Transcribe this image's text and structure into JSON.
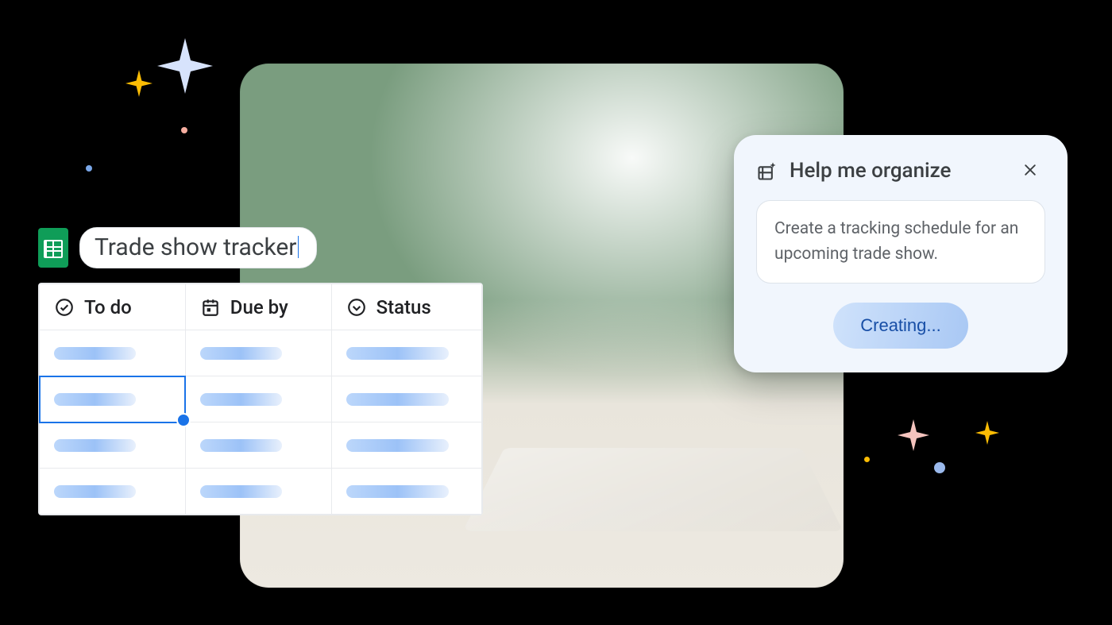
{
  "doc": {
    "title": "Trade show tracker"
  },
  "columns": {
    "todo": "To do",
    "dueby": "Due by",
    "status": "Status"
  },
  "panel": {
    "title": "Help me organize",
    "prompt": "Create a tracking schedule for an upcoming trade show.",
    "action": "Creating..."
  },
  "icons": {
    "sheets": "sheets-logo",
    "todo": "check-circle-icon",
    "dueby": "calendar-icon",
    "status": "dropdown-circle-icon",
    "hmo": "organize-sparkle-icon",
    "close": "close-icon"
  }
}
